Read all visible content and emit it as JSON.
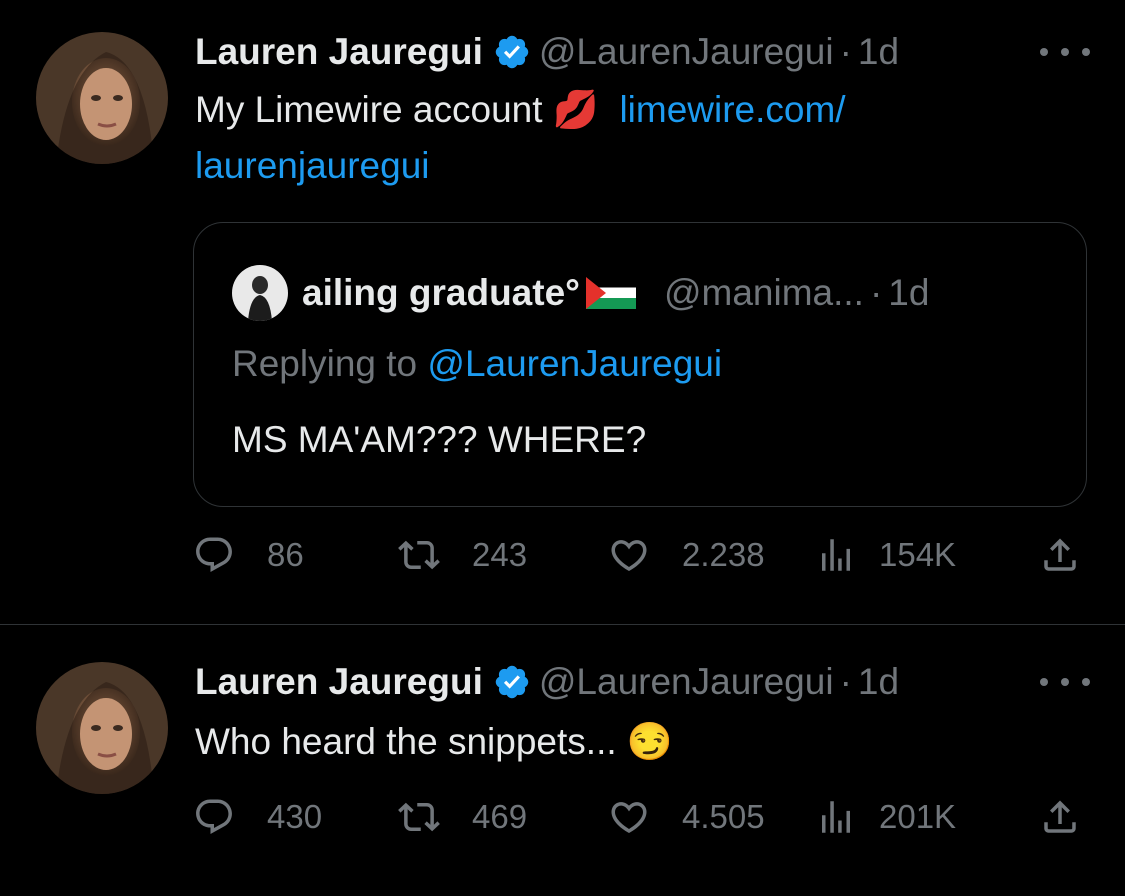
{
  "tweets": [
    {
      "author": "Lauren Jauregui",
      "handle": "@LaurenJauregui",
      "separator": "·",
      "time": "1d",
      "text_before": "My Limewire account",
      "emoji": "💋",
      "link": "limewire.com/ laurenjauregui",
      "quote": {
        "author": "ailing graduate°",
        "handle": "@manima...",
        "separator": "·",
        "time": "1d",
        "reply_prefix": "Replying to",
        "reply_handle": "@LaurenJauregui",
        "text": "MS MA'AM??? WHERE?"
      },
      "stats": {
        "replies": "86",
        "retweets": "243",
        "likes": "2.238",
        "views": "154K"
      }
    },
    {
      "author": "Lauren Jauregui",
      "handle": "@LaurenJauregui",
      "separator": "·",
      "time": "1d",
      "text_before": "Who heard the snippets...",
      "emoji": "😏",
      "stats": {
        "replies": "430",
        "retweets": "469",
        "likes": "4.505",
        "views": "201K"
      }
    }
  ],
  "colors": {
    "background": "#000000",
    "text": "#e7e9ea",
    "muted": "#71767b",
    "link": "#1d9bf0",
    "border": "#2f3336"
  },
  "icons": [
    "verified-badge-icon",
    "more-icon",
    "reply-icon",
    "retweet-icon",
    "like-icon",
    "views-icon",
    "share-icon",
    "palestine-flag-icon"
  ]
}
